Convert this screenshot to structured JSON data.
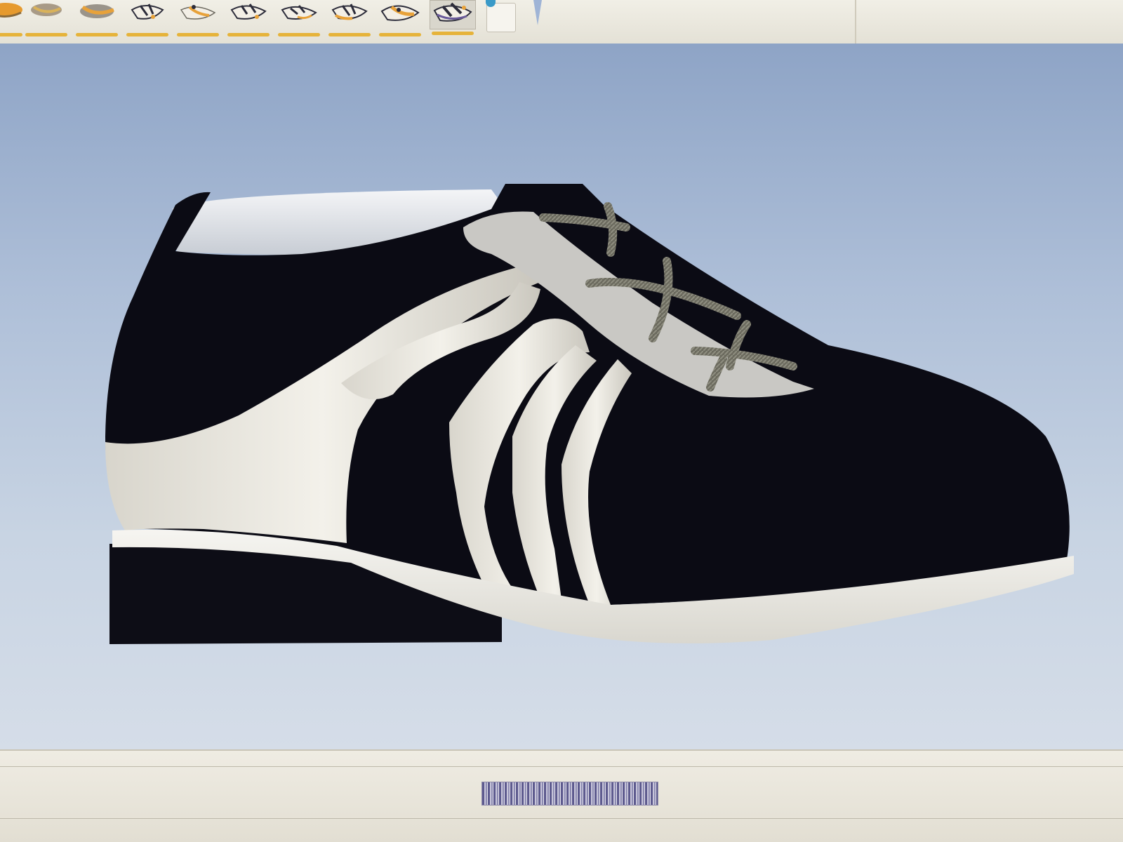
{
  "toolbar": {
    "thumbnails": [
      {
        "name": "variant-1",
        "accent": "#e69a2e"
      },
      {
        "name": "variant-2",
        "accent": "#d9b25a"
      },
      {
        "name": "variant-3",
        "accent": "#e8a23a"
      },
      {
        "name": "variant-4",
        "accent": "#2c2c3a"
      },
      {
        "name": "variant-5",
        "accent": "#e8a23a"
      },
      {
        "name": "variant-6",
        "accent": "#2c2c3a"
      },
      {
        "name": "variant-7",
        "accent": "#e8a23a"
      },
      {
        "name": "variant-8",
        "accent": "#e8a23a"
      },
      {
        "name": "variant-9",
        "accent": "#e8a23a"
      },
      {
        "name": "variant-10",
        "accent": "#6a5a9a",
        "selected": true
      }
    ],
    "underline_color": "#e6b33a"
  },
  "viewport": {
    "model": "lace-up-shoe",
    "colors": {
      "upper": "#0b0b14",
      "flame_overlay": "#dcdad3",
      "collar": "#e6e9ee",
      "sole": "#ecebe6",
      "heel": "#0d0d16",
      "laces": "#6b6a5e",
      "background_top": "#8ea4c6",
      "background_bottom": "#d5dde8"
    }
  },
  "status": {
    "progress_fraction": 1.0,
    "progress_color": "#5d5a8e"
  }
}
